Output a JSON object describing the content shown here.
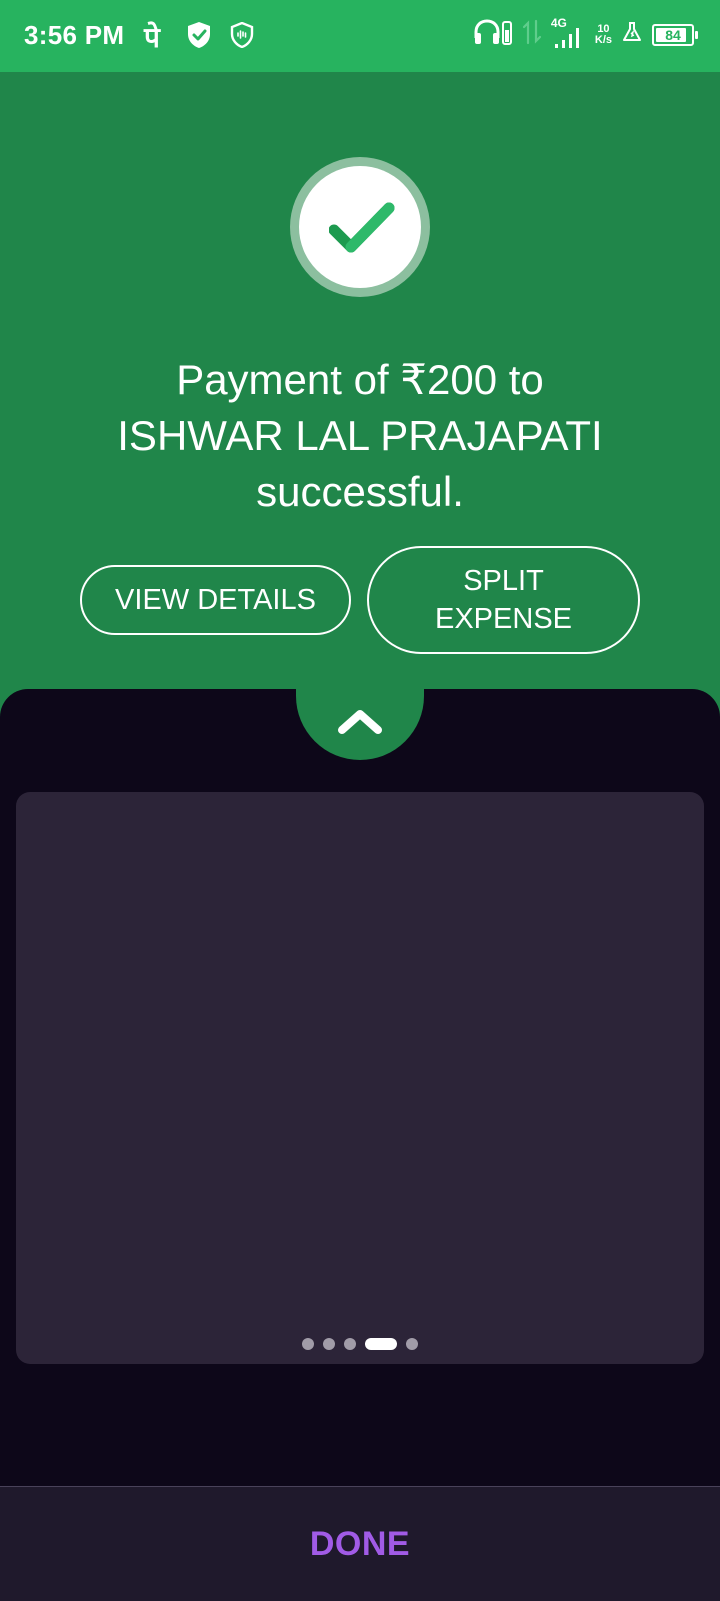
{
  "status_bar": {
    "time": "3:56 PM",
    "app_glyph": "पे",
    "network_type": "4G",
    "net_speed_value": "10",
    "net_speed_unit": "K/s",
    "battery": "84",
    "icons": [
      "phonepe-icon",
      "shield-check-icon",
      "shield-scan-icon",
      "headphones-battery-icon",
      "data-arrows-icon",
      "signal-icon",
      "flask-icon",
      "battery-icon"
    ]
  },
  "success": {
    "line1": "Payment of ₹200 to",
    "line2": "ISHWAR LAL PRAJAPATI",
    "line3": "successful.",
    "icon": "check-icon"
  },
  "actions": {
    "view_details": "VIEW DETAILS",
    "split_line1": "SPLIT",
    "split_line2": "EXPENSE"
  },
  "sheet": {
    "expand_icon": "chevron-up-icon",
    "carousel_page_count": 5,
    "carousel_active_index": 3
  },
  "footer": {
    "done_label": "DONE"
  },
  "colors": {
    "status_green": "#27b35f",
    "success_green": "#20864a",
    "sheet_dark": "#0d0719",
    "card": "#2c2438",
    "done_purple": "#a15be6"
  }
}
